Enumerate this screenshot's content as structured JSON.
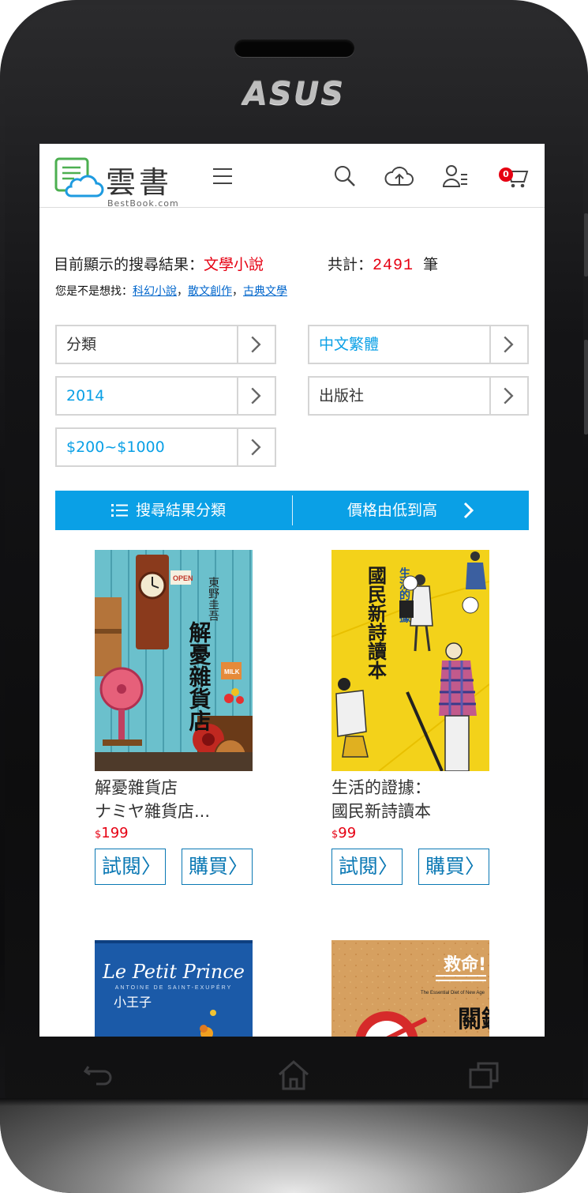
{
  "device": {
    "brand": "ASUS"
  },
  "app": {
    "logo_text": "雲書",
    "logo_subtext": "BestBook.com",
    "cart_count": "0"
  },
  "results": {
    "label": "目前顯示的搜尋結果：",
    "keyword": "文學小說",
    "total_label": "共計：",
    "total_count": "2491",
    "total_unit": "筆"
  },
  "suggestions": {
    "label": "您是不是想找：",
    "items": [
      "科幻小說",
      "散文創作",
      "古典文學"
    ],
    "separator": "，"
  },
  "filters": [
    {
      "label": "分類",
      "active": false
    },
    {
      "label": "中文繁體",
      "active": true
    },
    {
      "label": "2014",
      "active": true
    },
    {
      "label": "出版社",
      "active": false
    },
    {
      "label": "$200~$1000",
      "active": true
    }
  ],
  "sortbar": {
    "category_label": "搜尋結果分類",
    "sort_label": "價格由低到高"
  },
  "books": [
    {
      "title_line1": "解憂雜貨店",
      "title_line2": "ナミヤ雜貨店...",
      "currency": "$",
      "price": "199",
      "preview_label": "試閱〉",
      "buy_label": "購買〉",
      "cover_author": "東野圭吾",
      "cover_title": "解憂雜貨店",
      "cover_sign": "OPEN",
      "cover_milk": "MILK"
    },
    {
      "title_line1": "生活的證據：",
      "title_line2": "國民新詩讀本",
      "currency": "$",
      "price": "99",
      "preview_label": "試閱〉",
      "buy_label": "購買〉",
      "cover_title": "國民新詩讀本",
      "cover_subtitle": "生活的證據"
    },
    {
      "cover_title_latin": "Le Petit Prince",
      "cover_author_latin": "ANTOINE DE SAINT-EXUPÉRY",
      "cover_title": "小王子"
    },
    {
      "cover_title": "救命!",
      "cover_subtitle": "The Essential Diet of New Age",
      "cover_title2": "關鍵"
    }
  ],
  "colors": {
    "accent_blue": "#0aa0e6",
    "price_red": "#e60012",
    "button_blue": "#0a78b4"
  }
}
